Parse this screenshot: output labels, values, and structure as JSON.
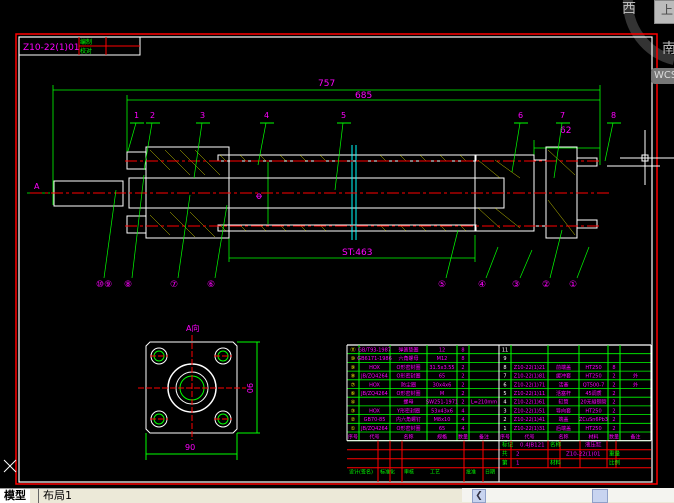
{
  "title_block_small": {
    "drawing_no": "Z10-22(1)01",
    "cell1": "编制",
    "cell2": "校对"
  },
  "dimensions": {
    "overall": "757",
    "body": "685",
    "end": "62",
    "stroke": "ST:463",
    "bore_mark": "Φ",
    "flange_width": "90",
    "flange_height": "90"
  },
  "view_label": "A向",
  "arrow_label": "A",
  "part_numbers": [
    "1",
    "2",
    "3",
    "4",
    "5",
    "6",
    "7",
    "8"
  ],
  "std_balloons": [
    "⑩⑨",
    "⑧",
    "⑦",
    "⑥",
    "⑤",
    "④",
    "③",
    "②",
    "①"
  ],
  "bom": {
    "rows": [
      {
        "l": [
          "⑪",
          "GB/T93-1987",
          "弹簧垫圈",
          "12",
          "8",
          ""
        ],
        "r": [
          "11",
          "",
          "",
          "",
          "",
          ""
        ]
      },
      {
        "l": [
          "⑩",
          "GB6171-1986",
          "六角螺母",
          "M12",
          "8",
          ""
        ],
        "r": [
          "9",
          "",
          "",
          "",
          "",
          ""
        ]
      },
      {
        "l": [
          "⑨",
          "HOX",
          "O形密封圈",
          "31.5x3.55",
          "2",
          ""
        ],
        "r": [
          "8",
          "Z10-22(1)21",
          "前端盖",
          "HT250",
          "8",
          ""
        ]
      },
      {
        "l": [
          "⑧",
          "JB/ZQ4264",
          "O形密封圈",
          "65",
          "2",
          ""
        ],
        "r": [
          "7",
          "Z10-22(1)81",
          "缓冲套",
          "HT250",
          "2",
          "外"
        ]
      },
      {
        "l": [
          "⑦",
          "HOX",
          "防尘圈",
          "30x4x6",
          "2",
          ""
        ],
        "r": [
          "6",
          "Z10-22(1)71",
          "活塞",
          "QT500-7",
          "2",
          "外"
        ]
      },
      {
        "l": [
          "⑥",
          "JB/ZQ4264",
          "O形密封圈",
          "M",
          "2",
          ""
        ],
        "r": [
          "5",
          "Z10-22(1)11",
          "活塞杆",
          "45调质",
          "2",
          ""
        ]
      },
      {
        "l": [
          "④",
          "",
          "螺母",
          "SW251-1971",
          "2",
          "L=210mm"
        ],
        "r": [
          "4",
          "Z10-22(1)61",
          "缸筒",
          "20无缝钢管",
          "2",
          ""
        ]
      },
      {
        "l": [
          "③",
          "HOX",
          "Y形密封圈",
          "53x43x6",
          "4",
          ""
        ],
        "r": [
          "3",
          "Z10-22(1)51",
          "导向套",
          "HT250",
          "2",
          ""
        ]
      },
      {
        "l": [
          "②",
          "GB70-85",
          "内六角螺钉",
          "M8x10",
          "4",
          ""
        ],
        "r": [
          "2",
          "Z10-22(1)41",
          "端盖",
          "ZCuSn6Pb3",
          "2",
          ""
        ]
      },
      {
        "l": [
          "①",
          "JB/ZQ4264",
          "O形密封圈",
          "65",
          "4",
          ""
        ],
        "r": [
          "1",
          "Z10-22(1)31",
          "后端盖",
          "HT250",
          "2",
          ""
        ]
      }
    ],
    "header_left": [
      "序号",
      "代号",
      "名称",
      "规格",
      "数量",
      "备注"
    ],
    "header_right": [
      "序号",
      "代号",
      "名称",
      "材料",
      "数量",
      "备注"
    ],
    "title": {
      "mark_label": "标记",
      "mark": "0.4JB121",
      "sheet_label": "共",
      "sheet": "2",
      "name_label": "名称",
      "drawing_no": "Z10-22(1)01",
      "page_label": "第",
      "page": "1",
      "material_label": "材料",
      "weight_label": "重量",
      "scale_label": "比例",
      "school": "液压缸"
    },
    "sign_row": [
      "设计(签名)",
      "标准化",
      "审核",
      "工艺",
      "批准",
      "日期"
    ]
  },
  "compass": {
    "west": "西",
    "south": "南",
    "top": "上",
    "ucs": "WCS"
  },
  "tabs": {
    "model": "模型",
    "layout1": "布局1"
  },
  "colors": {
    "frame": "#ff0000",
    "border": "#ffffff",
    "text": "#ff00ff",
    "lines": "#00ff00",
    "center": "#ff0000"
  }
}
